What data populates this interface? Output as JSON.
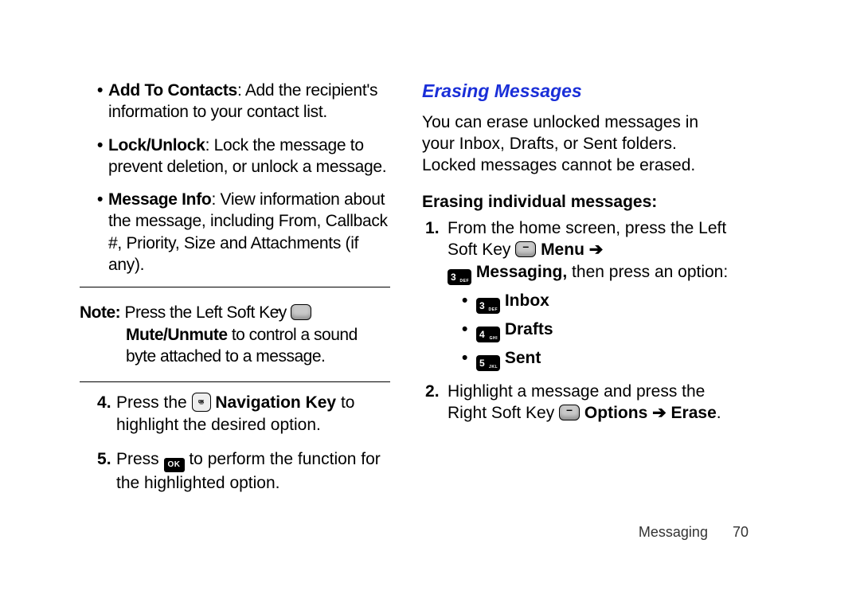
{
  "left": {
    "bullets": [
      {
        "bold": "Add To Contacts",
        "text": ": Add the recipient's information to your contact list."
      },
      {
        "bold": "Lock/Unlock",
        "text": ": Lock the message to prevent deletion, or unlock a message."
      },
      {
        "bold": "Message Info",
        "text": ": View information about the message, including From, Callback #, Priority, Size and Attachments (if any)."
      }
    ],
    "note_label": "Note:",
    "note_pre": "Press the Left Soft Key ",
    "note_mute": "Mute/Unmute",
    "note_post": " to control a sound byte attached to a message.",
    "step4_pre": "Press the ",
    "step4_key_label": "Navigation Key",
    "step4_post": " to highlight the desired option.",
    "step5_pre": "Press ",
    "step5_post": " to perform the function for the highlighted option.",
    "ok_label": "OK"
  },
  "right": {
    "heading": "Erasing Messages",
    "intro": "You can erase unlocked messages in your Inbox, Drafts, or Sent folders. Locked messages cannot be erased.",
    "sub": "Erasing individual messages:",
    "s1_a": "From the home screen, press the Left Soft Key ",
    "s1_menu": "Menu",
    "arrow": "➔",
    "s1_msg": "Messaging,",
    "s1_b": " then press an option:",
    "key3_num": "3",
    "key3_sub": "DEF",
    "key4_num": "4",
    "key4_sub": "GHI",
    "key5_num": "5",
    "key5_sub": "JKL",
    "inbox": "Inbox",
    "drafts": "Drafts",
    "sent": "Sent",
    "s2_a": "Highlight a message and press the Right Soft Key ",
    "s2_options": "Options",
    "s2_erase": "Erase"
  },
  "footer": {
    "section": "Messaging",
    "page": "70"
  }
}
